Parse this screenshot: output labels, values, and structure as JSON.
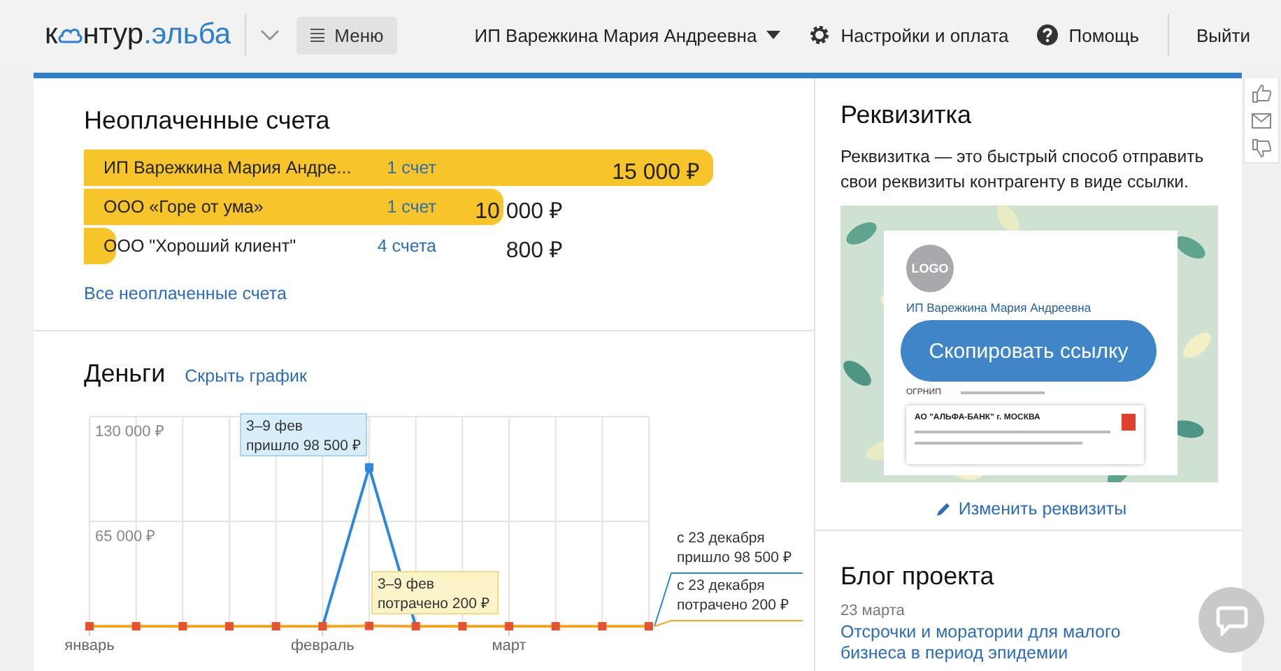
{
  "header": {
    "logo": {
      "prefix": "к",
      "rest": "нтур",
      "suffix": ".эльба"
    },
    "menu_button": "Меню",
    "user": "ИП Варежкина Мария Андреевна",
    "settings": "Настройки и оплата",
    "help": "Помощь",
    "logout": "Выйти"
  },
  "unpaid": {
    "title": "Неоплаченные счета",
    "rows": [
      {
        "name": "ИП Варежкина Мария Андре...",
        "count": "1 счет",
        "amount": "15 000 ₽",
        "level": 1
      },
      {
        "name": "ООО «Горе от ума»",
        "count": "1 счет",
        "amount": "10 000 ₽",
        "level": 0.667
      },
      {
        "name": "ООО \"Хороший клиент\"",
        "count": "4 счета",
        "amount": "800 ₽",
        "level": 0.05
      }
    ],
    "all_link": "Все неоплаченные счета"
  },
  "money": {
    "title": "Деньги",
    "toggle_link": "Скрыть график",
    "chart_data": {
      "type": "line",
      "categories": [
        "январь",
        null,
        null,
        null,
        null,
        "февраль",
        null,
        null,
        null,
        "март",
        null,
        null,
        null
      ],
      "ylim": [
        0,
        130000
      ],
      "grid": true,
      "yticks": [
        {
          "value": 65000,
          "label": "65 000 ₽"
        },
        {
          "value": 130000,
          "label": "130 000 ₽"
        }
      ],
      "series": [
        {
          "color": "#2f86dd",
          "marker": "square",
          "values": [
            null,
            null,
            null,
            null,
            null,
            0,
            98500,
            0,
            null,
            null,
            null,
            null,
            null
          ]
        },
        {
          "color": "#f5a623",
          "marker": "square",
          "values": [
            0,
            0,
            0,
            0,
            0,
            0,
            200,
            0,
            0,
            0,
            0,
            0,
            0
          ]
        }
      ]
    },
    "tooltips": [
      {
        "period": "3–9 фев",
        "text": "пришло 98 500 ₽"
      },
      {
        "period": "3–9 фев",
        "text": "потрачено 200 ₽"
      }
    ],
    "legend": [
      {
        "period": "с 23 декабря",
        "text": "пришло 98 500 ₽"
      },
      {
        "period": "с 23 декабря",
        "text": "потрачено 200 ₽"
      }
    ]
  },
  "requisites": {
    "title": "Реквизитка",
    "description": "Реквизитка — это быстрый способ отправить свои реквизиты контрагенту в виде ссылки.",
    "card": {
      "logo": "LOGO",
      "name": "ИП Варежкина Мария Андреевна",
      "field_label": "ОГРНИП",
      "bank": "АО \"АЛЬФА-БАНК\" г. МОСКВА",
      "copy_button": "Скопировать ссылку"
    },
    "edit_link": "Изменить реквизиты"
  },
  "blog": {
    "title": "Блог проекта",
    "posts": [
      {
        "date": "23 марта",
        "title": "Отсрочки и моратории для малого бизнеса в период эпидемии"
      }
    ]
  }
}
